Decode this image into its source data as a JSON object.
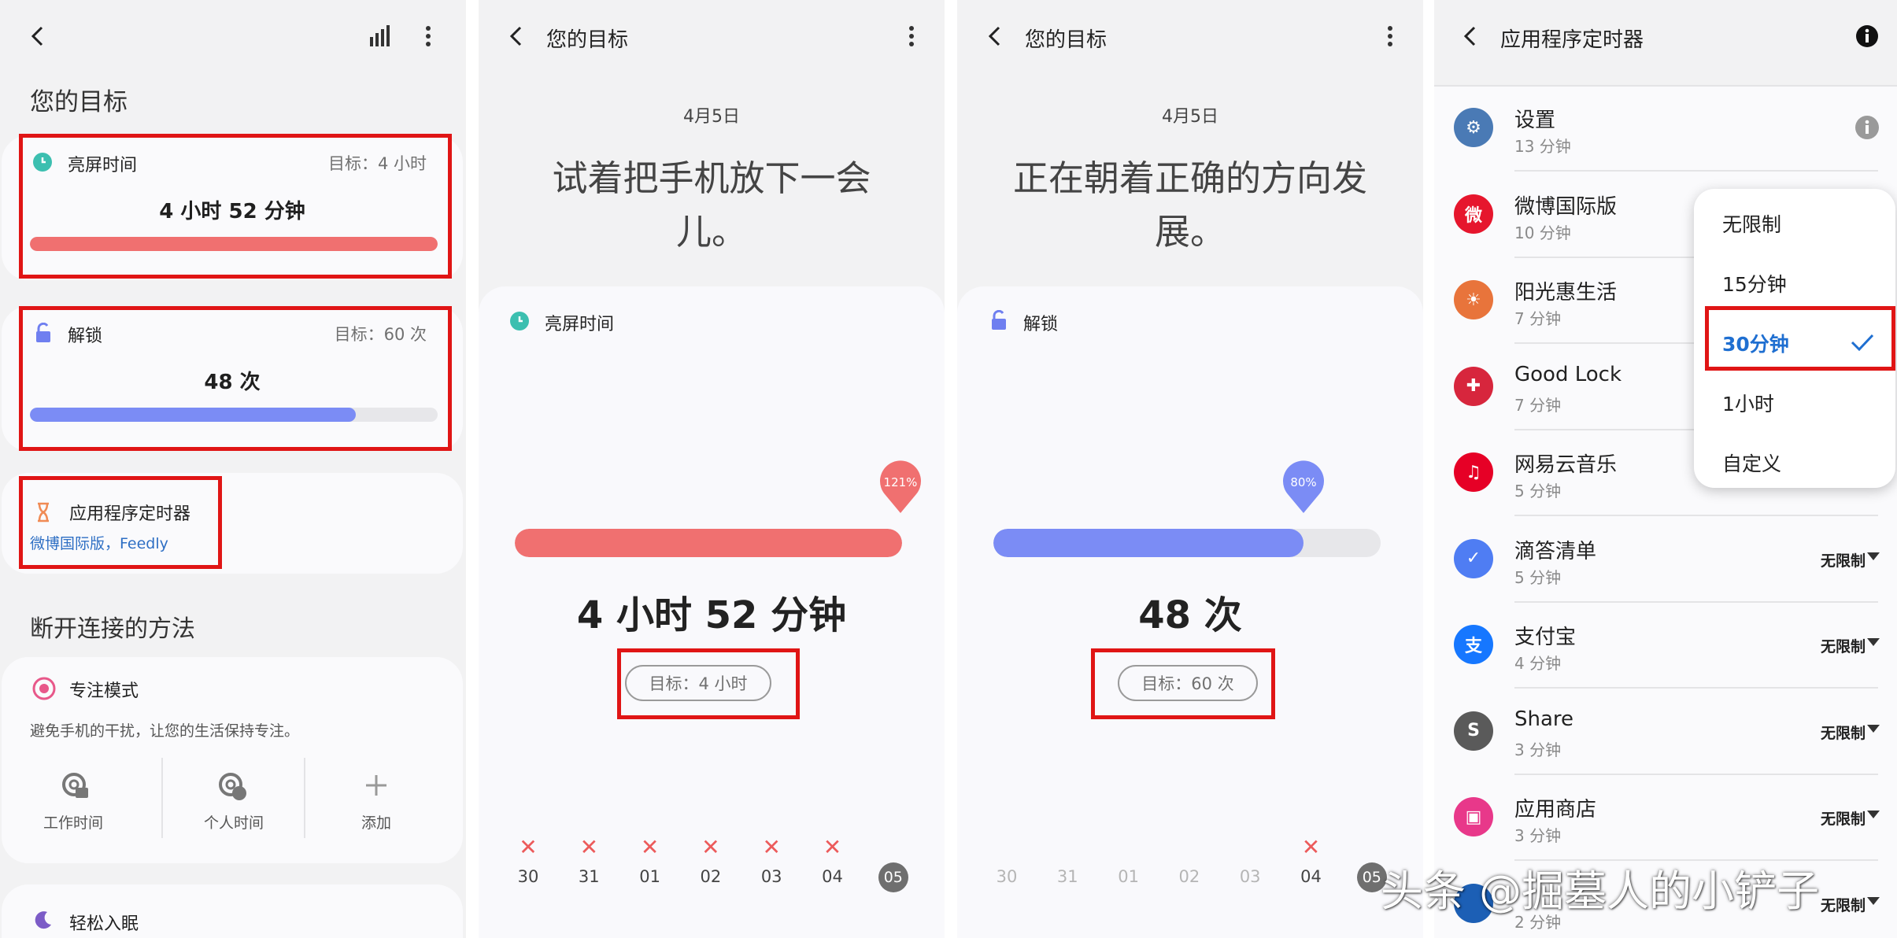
{
  "panel1": {
    "title": "您的目标",
    "screen_time": {
      "label": "亮屏时间",
      "goal": "目标：4 小时",
      "value": "4 小时 52 分钟",
      "progress": 1.0,
      "color": "#f07070"
    },
    "unlocks": {
      "label": "解锁",
      "goal": "目标：60 次",
      "value": "48 次",
      "progress": 0.8,
      "color": "#7b8cf5"
    },
    "app_timer": {
      "label": "应用程序定时器",
      "apps": "微博国际版，Feedly"
    },
    "disconnect_heading": "断开连接的方法",
    "focus": {
      "label": "专注模式",
      "description": "避免手机的干扰，让您的生活保持专注。",
      "buttons": [
        {
          "label": "工作时间",
          "icon": "work-focus-icon"
        },
        {
          "label": "个人时间",
          "icon": "personal-focus-icon"
        },
        {
          "label": "添加",
          "icon": "plus-icon"
        }
      ]
    },
    "sleep": {
      "label": "轻松入眠"
    }
  },
  "panel2": {
    "title": "您的目标",
    "date": "4月5日",
    "headline_line1": "试着把手机放下一会",
    "headline_line2": "儿。",
    "metric_label": "亮屏时间",
    "percent": "121%",
    "progress": 1.0,
    "value": "4 小时 52 分钟",
    "goal": "目标：4 小时",
    "days": [
      "30",
      "31",
      "01",
      "02",
      "03",
      "04",
      "05"
    ],
    "missed": [
      true,
      true,
      true,
      true,
      true,
      true,
      false
    ]
  },
  "panel3": {
    "title": "您的目标",
    "date": "4月5日",
    "headline_line1": "正在朝着正确的方向发",
    "headline_line2": "展。",
    "metric_label": "解锁",
    "percent": "80%",
    "progress": 0.8,
    "value": "48 次",
    "goal": "目标：60 次",
    "days": [
      "30",
      "31",
      "01",
      "02",
      "03",
      "04",
      "05"
    ],
    "missed": [
      false,
      false,
      false,
      false,
      false,
      true,
      false
    ]
  },
  "panel4": {
    "title": "应用程序定时器",
    "apps": [
      {
        "name": "设置",
        "time": "13 分钟",
        "icon": "settings-app-icon",
        "color": "#4a7ab5",
        "glyph": "⚙",
        "limit": ""
      },
      {
        "name": "微博国际版",
        "time": "10 分钟",
        "icon": "weibo-app-icon",
        "color": "#e6162d",
        "glyph": "微",
        "limit": ""
      },
      {
        "name": "阳光惠生活",
        "time": "7 分钟",
        "icon": "sunshine-app-icon",
        "color": "#e8743b",
        "glyph": "☀",
        "limit": ""
      },
      {
        "name": "Good Lock",
        "time": "7 分钟",
        "icon": "goodlock-app-icon",
        "color": "#d7263d",
        "glyph": "✚",
        "limit": ""
      },
      {
        "name": "网易云音乐",
        "time": "5 分钟",
        "icon": "netease-music-app-icon",
        "color": "#e60026",
        "glyph": "♫",
        "limit": ""
      },
      {
        "name": "滴答清单",
        "time": "5 分钟",
        "icon": "ticktick-app-icon",
        "color": "#4f7df3",
        "glyph": "✓",
        "limit": "无限制"
      },
      {
        "name": "支付宝",
        "time": "4 分钟",
        "icon": "alipay-app-icon",
        "color": "#1677ff",
        "glyph": "支",
        "limit": "无限制"
      },
      {
        "name": "Share",
        "time": "3 分钟",
        "icon": "share-app-icon",
        "color": "#5a5a5a",
        "glyph": "S",
        "limit": "无限制"
      },
      {
        "name": "应用商店",
        "time": "3 分钟",
        "icon": "galaxy-store-app-icon",
        "color": "#e8388a",
        "glyph": "▣",
        "limit": "无限制"
      },
      {
        "name": "",
        "time": "2 分钟",
        "icon": "railway-app-icon",
        "color": "#1c5fb5",
        "glyph": "",
        "limit": "无限制"
      }
    ],
    "menu": [
      "无限制",
      "15分钟",
      "30分钟",
      "1小时",
      "自定义"
    ],
    "menu_selected": 2
  },
  "watermark": "头条 @掘墓人的小铲子"
}
